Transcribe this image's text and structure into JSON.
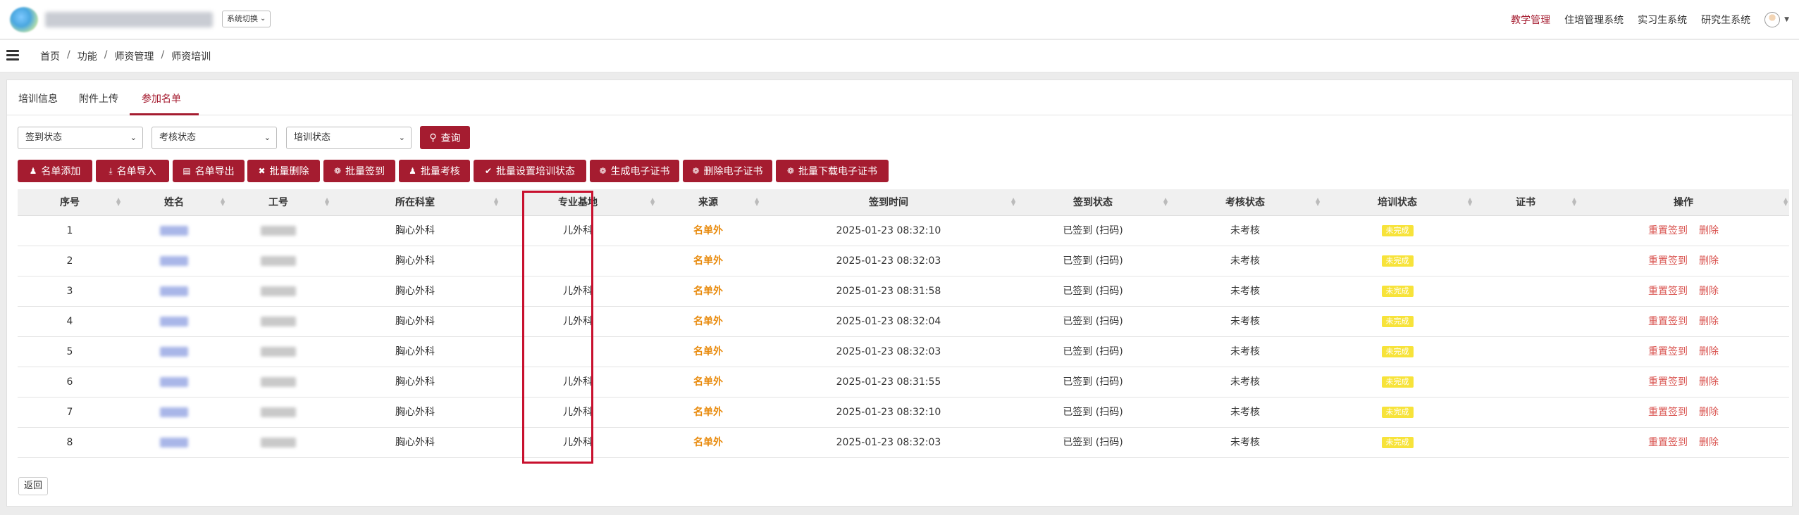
{
  "header": {
    "system_switch": "系统切换",
    "nav": [
      "教学管理",
      "住培管理系统",
      "实习生系统",
      "研究生系统"
    ],
    "active_nav": "教学管理"
  },
  "breadcrumb": [
    "首页",
    "功能",
    "师资管理",
    "师资培训"
  ],
  "tabs": [
    "培训信息",
    "附件上传",
    "参加名单"
  ],
  "active_tab": "参加名单",
  "filters": {
    "sign_status": "签到状态",
    "assess_status": "考核状态",
    "train_status": "培训状态",
    "query_label": "查询"
  },
  "actions": [
    "名单添加",
    "名单导入",
    "名单导出",
    "批量删除",
    "批量签到",
    "批量考核",
    "批量设置培训状态",
    "生成电子证书",
    "删除电子证书",
    "批量下载电子证书"
  ],
  "table": {
    "columns": [
      "序号",
      "姓名",
      "工号",
      "所在科室",
      "专业基地",
      "来源",
      "签到时间",
      "签到状态",
      "考核状态",
      "培训状态",
      "证书",
      "操作"
    ],
    "rows": [
      {
        "no": "1",
        "dept": "胸心外科",
        "base": "儿外科",
        "source": "名单外",
        "time": "2025-01-23 08:32:10",
        "sign": "已签到 (扫码)",
        "assess": "未考核",
        "train": "未完成"
      },
      {
        "no": "2",
        "dept": "胸心外科",
        "base": "",
        "source": "名单外",
        "time": "2025-01-23 08:32:03",
        "sign": "已签到 (扫码)",
        "assess": "未考核",
        "train": "未完成"
      },
      {
        "no": "3",
        "dept": "胸心外科",
        "base": "儿外科",
        "source": "名单外",
        "time": "2025-01-23 08:31:58",
        "sign": "已签到 (扫码)",
        "assess": "未考核",
        "train": "未完成"
      },
      {
        "no": "4",
        "dept": "胸心外科",
        "base": "儿外科",
        "source": "名单外",
        "time": "2025-01-23 08:32:04",
        "sign": "已签到 (扫码)",
        "assess": "未考核",
        "train": "未完成"
      },
      {
        "no": "5",
        "dept": "胸心外科",
        "base": "",
        "source": "名单外",
        "time": "2025-01-23 08:32:03",
        "sign": "已签到 (扫码)",
        "assess": "未考核",
        "train": "未完成"
      },
      {
        "no": "6",
        "dept": "胸心外科",
        "base": "儿外科",
        "source": "名单外",
        "time": "2025-01-23 08:31:55",
        "sign": "已签到 (扫码)",
        "assess": "未考核",
        "train": "未完成"
      },
      {
        "no": "7",
        "dept": "胸心外科",
        "base": "儿外科",
        "source": "名单外",
        "time": "2025-01-23 08:32:10",
        "sign": "已签到 (扫码)",
        "assess": "未考核",
        "train": "未完成"
      },
      {
        "no": "8",
        "dept": "胸心外科",
        "base": "儿外科",
        "source": "名单外",
        "time": "2025-01-23 08:32:03",
        "sign": "已签到 (扫码)",
        "assess": "未考核",
        "train": "未完成"
      }
    ],
    "ops": [
      "重置签到",
      "删除"
    ]
  },
  "back_label": "返回",
  "colors": {
    "accent": "#a51c30",
    "source": "#e88a0c",
    "badge": "#f7e33a",
    "op_link": "#d9534f"
  }
}
